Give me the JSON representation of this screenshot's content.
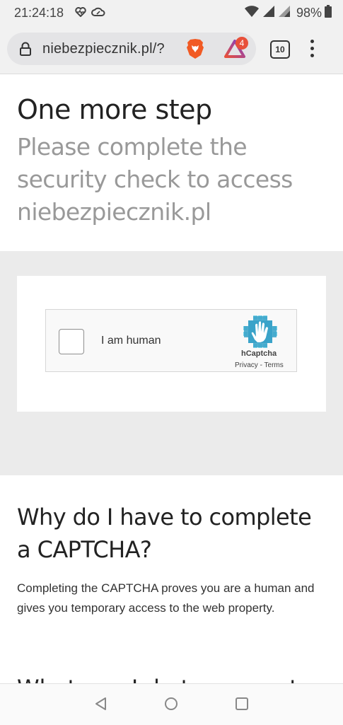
{
  "status_bar": {
    "time": "21:24:18",
    "battery": "98%",
    "icons": [
      "heart-monitor-icon",
      "cloud-icon",
      "wifi-icon",
      "signal-icon",
      "signal-icon",
      "battery-icon"
    ]
  },
  "browser": {
    "url": "niebezpiecznik.pl/?",
    "rewards_badge": "4",
    "tab_count": "10",
    "icons": [
      "lock-icon",
      "brave-shield-icon",
      "brave-rewards-icon",
      "tabs-icon",
      "more-menu-icon"
    ]
  },
  "page": {
    "title": "One more step",
    "subtitle": "Please complete the security check to access niebezpiecznik.pl",
    "captcha": {
      "checkbox_label": "I am human",
      "brand": "hCaptcha",
      "privacy": "Privacy",
      "separator": " - ",
      "terms": "Terms"
    },
    "why": {
      "heading": "Why do I have to complete a CAPTCHA?",
      "body": "Completing the CAPTCHA proves you are a human and gives you temporary access to the web property.",
      "next_heading_partial": "What can I do to prevent"
    }
  },
  "navigation": {
    "icons": [
      "back-icon",
      "home-icon",
      "recents-icon"
    ]
  },
  "colors": {
    "background": "#ffffff",
    "gray_area": "#ebebeb",
    "subtitle": "#999999",
    "hcaptcha_accent": "#3aa3c9",
    "brave_orange": "#f15a24"
  }
}
